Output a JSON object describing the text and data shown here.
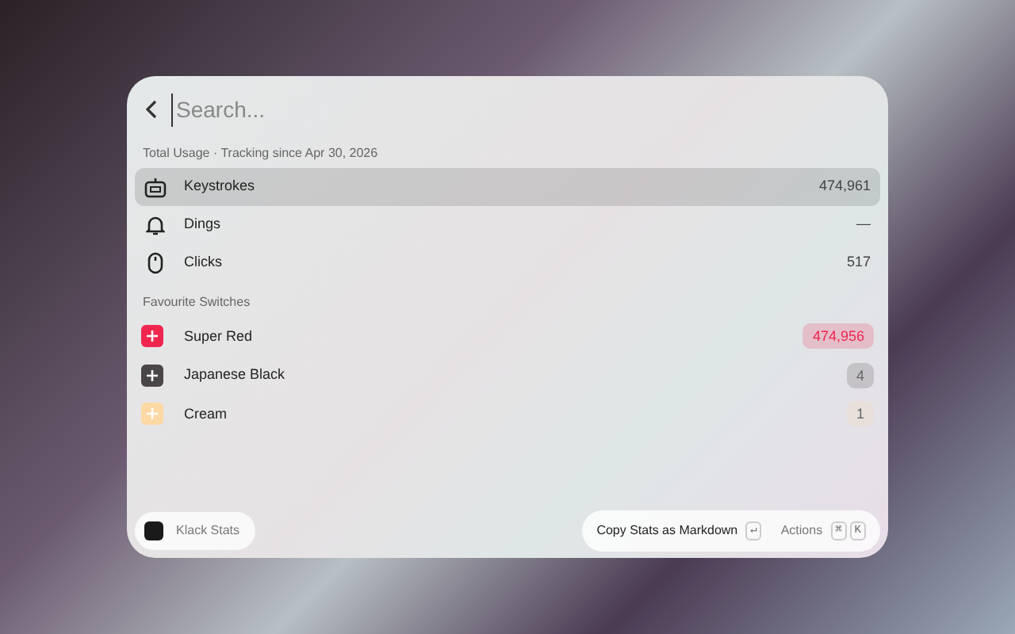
{
  "search": {
    "placeholder": "Search..."
  },
  "usage": {
    "header": "Total Usage · Tracking since Apr 30, 2026",
    "items": [
      {
        "kind": "keyboard",
        "label": "Keystrokes",
        "value": "474,961",
        "selected": true
      },
      {
        "kind": "bell",
        "label": "Dings",
        "value": "—",
        "selected": false
      },
      {
        "kind": "mouse",
        "label": "Clicks",
        "value": "517",
        "selected": false
      }
    ]
  },
  "switches": {
    "header": "Favourite Switches",
    "items": [
      {
        "label": "Super Red",
        "value": "474,956",
        "color": "#f0264f"
      },
      {
        "label": "Japanese Black",
        "value": "4",
        "color": "#4a4648"
      },
      {
        "label": "Cream",
        "value": "1",
        "color": "#fcd9a4"
      }
    ]
  },
  "footer": {
    "app": "Klack Stats",
    "primary_action": "Copy Stats as Markdown",
    "primary_key": "↵",
    "actions": "Actions",
    "action_keys": [
      "⌘",
      "K"
    ]
  }
}
